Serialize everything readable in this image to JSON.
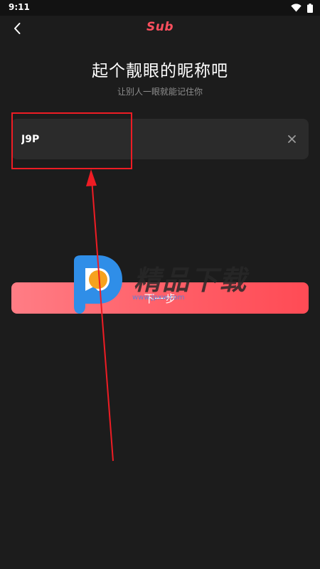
{
  "status_bar": {
    "time": "9:11",
    "icons": [
      "wifi-icon",
      "battery-icon"
    ]
  },
  "header": {
    "back_icon": "chevron-left-icon",
    "logo": "Sub"
  },
  "main": {
    "title": "起个靓眼的昵称吧",
    "subtitle": "让别人一眼就能记住你",
    "nickname": {
      "value": "J9P",
      "placeholder": "",
      "clear_icon": "close-icon"
    },
    "next_button_label": "下一步"
  },
  "watermark": {
    "text": "精品下载",
    "url": "www.jpxw.com"
  },
  "colors": {
    "accent": "#ff4f5e",
    "background": "#1c1c1c",
    "field_background": "#2b2b2b",
    "annotation": "#ee1c24"
  }
}
